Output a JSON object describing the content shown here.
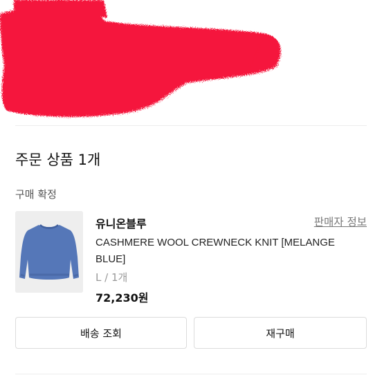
{
  "order_section": {
    "title": "주문 상품 1개",
    "status": "구매 확정"
  },
  "product": {
    "brand": "유니온블루",
    "seller_info_link": "판매자 정보",
    "name": "CASHMERE WOOL CREWNECK KNIT [MELANGE BLUE]",
    "option": "L / 1개",
    "price": "72,230원",
    "image": "blue-knit-sweater"
  },
  "actions": {
    "track_delivery": "배송 조회",
    "reorder": "재구매"
  },
  "colors": {
    "redaction": "#f5143c",
    "sweater": "#5577b8",
    "thumb_bg": "#eeeeee"
  }
}
